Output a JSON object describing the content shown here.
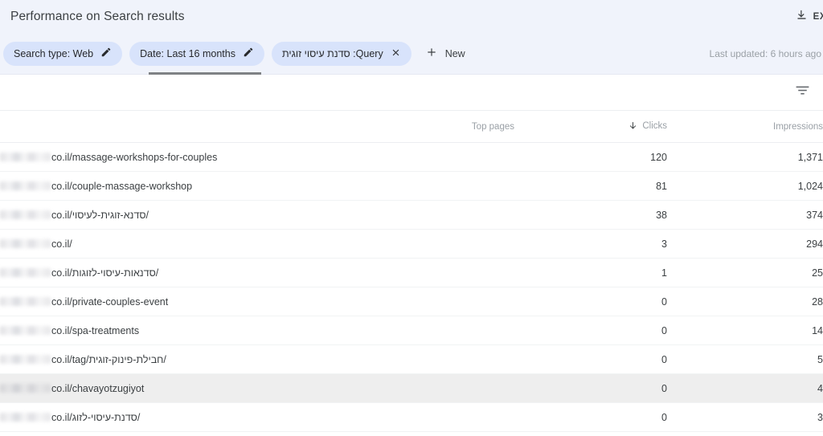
{
  "header": {
    "title": "Performance on Search results",
    "export": {
      "label": "EXPO",
      "icon": "download-icon"
    }
  },
  "filters": {
    "chips": [
      {
        "label": "Search type: Web",
        "action_icon": "pencil-icon"
      },
      {
        "label": "Date: Last 16 months",
        "action_icon": "pencil-icon"
      },
      {
        "label": "Query: סדנת עיסוי זוגית",
        "action_icon": "close-icon"
      }
    ],
    "new_button": {
      "label": "New",
      "icon": "plus-icon"
    },
    "last_updated": "Last updated: 6 hours ago"
  },
  "toolbar": {
    "filter_icon": "tune-icon"
  },
  "table": {
    "columns": {
      "page": "Top pages",
      "clicks": "Clicks",
      "impressions": "Impressions"
    },
    "sort": {
      "column": "clicks",
      "direction": "desc",
      "icon": "arrow-down-icon"
    },
    "row_actions": [
      "copy-icon",
      "open-in-new-icon",
      "search-icon"
    ],
    "hovered_row_index": 8,
    "rows": [
      {
        "url": "co.il/massage-workshops-for-couples",
        "clicks": "120",
        "impressions": "1,371"
      },
      {
        "url": "co.il/couple-massage-workshop",
        "clicks": "81",
        "impressions": "1,024"
      },
      {
        "url": "co.il/סדנא-זוגית-לעיסוי/",
        "clicks": "38",
        "impressions": "374"
      },
      {
        "url": "co.il/",
        "clicks": "3",
        "impressions": "294"
      },
      {
        "url": "co.il/סדנאות-עיסוי-לזוגות/",
        "clicks": "1",
        "impressions": "25"
      },
      {
        "url": "co.il/private-couples-event",
        "clicks": "0",
        "impressions": "28"
      },
      {
        "url": "co.il/spa-treatments",
        "clicks": "0",
        "impressions": "14"
      },
      {
        "url": "co.il/tag/חבילת-פינוק-זוגית/",
        "clicks": "0",
        "impressions": "5"
      },
      {
        "url": "co.il/chavayotzugiyot",
        "clicks": "0",
        "impressions": "4"
      },
      {
        "url": "co.il/סדנת-עיסוי-לזוג/",
        "clicks": "0",
        "impressions": "3"
      }
    ]
  },
  "colors": {
    "header_bg": "#f0f3fb",
    "chip_bg": "#d8e3fb",
    "clicks": "#6b8ee8",
    "impressions": "#8a63b5",
    "hover_row": "#eeeeee",
    "tab_indicator": "#7f8285"
  }
}
